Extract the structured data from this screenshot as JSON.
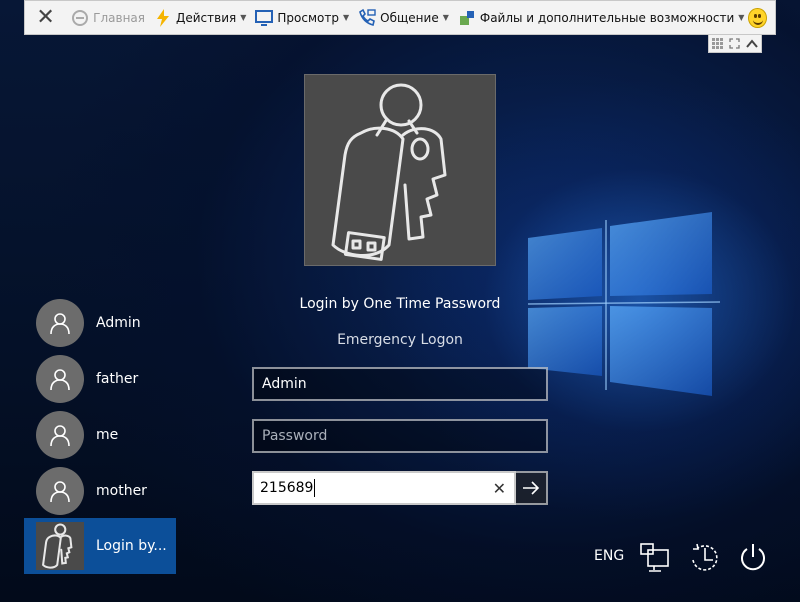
{
  "toolbar": {
    "home_label": "Главная",
    "actions_label": "Действия",
    "view_label": "Просмотр",
    "communication_label": "Общение",
    "files_label": "Файлы и дополнительные возможности"
  },
  "login": {
    "title": "Login by One Time Password",
    "emergency_link": "Emergency Logon",
    "username_value": "Admin",
    "password_placeholder": "Password",
    "otp_value": "215689"
  },
  "users": [
    {
      "name": "Admin"
    },
    {
      "name": "father"
    },
    {
      "name": "me"
    },
    {
      "name": "mother"
    }
  ],
  "selected_user": {
    "name": "Login by..."
  },
  "system": {
    "language": "ENG"
  },
  "colors": {
    "accent": "#0c4f99",
    "toolbar_bg": "#f3f3f3",
    "tile_bg": "#4a4a4a"
  }
}
